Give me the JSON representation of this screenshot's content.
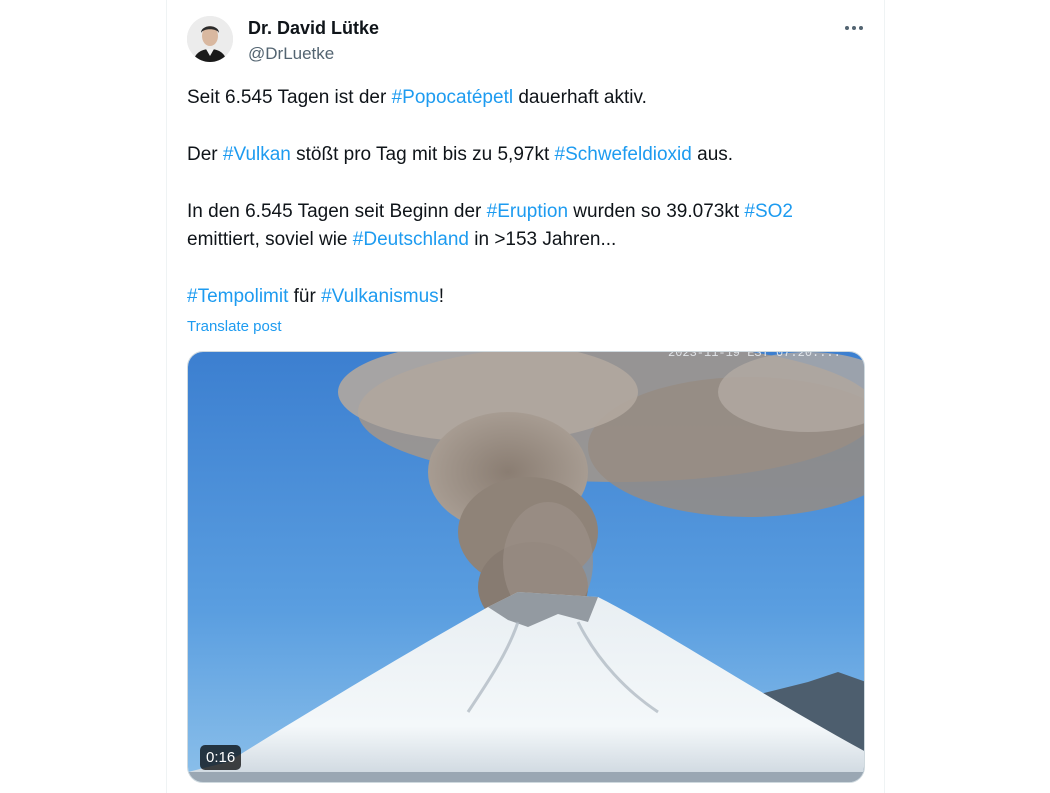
{
  "author": {
    "display_name": "Dr. David Lütke",
    "handle": "@DrLuetke",
    "avatar_icon": "user-avatar-photo"
  },
  "menu_icon": "more-options-icon",
  "tweet": {
    "p1": {
      "t1": "Seit 6.545 Tagen ist der ",
      "h1": "#Popocatépetl",
      "t2": " dauerhaft aktiv."
    },
    "p2": {
      "t1": "Der ",
      "h1": "#Vulkan",
      "t2": " stößt pro Tag mit bis zu 5,97kt ",
      "h2": "#Schwefeldioxid",
      "t3": " aus."
    },
    "p3": {
      "t1": "In den 6.545 Tagen seit Beginn der ",
      "h1": "#Eruption",
      "t2": " wurden so 39.073kt ",
      "h2": "#SO2",
      "t3": "emittiert, soviel wie ",
      "h3": "#Deutschland",
      "t4": " in >153 Jahren..."
    },
    "p4": {
      "h1": "#Tempolimit",
      "t1": " für ",
      "h2": "#Vulkanismus",
      "t2": "!"
    }
  },
  "translate_label": "Translate post",
  "media": {
    "type": "video",
    "duration": "0:16",
    "timestamp_overlay": "2023-11-19 EST 07:20:..."
  },
  "colors": {
    "link": "#1d9bf0",
    "text": "#0f1419",
    "secondary": "#536471"
  }
}
